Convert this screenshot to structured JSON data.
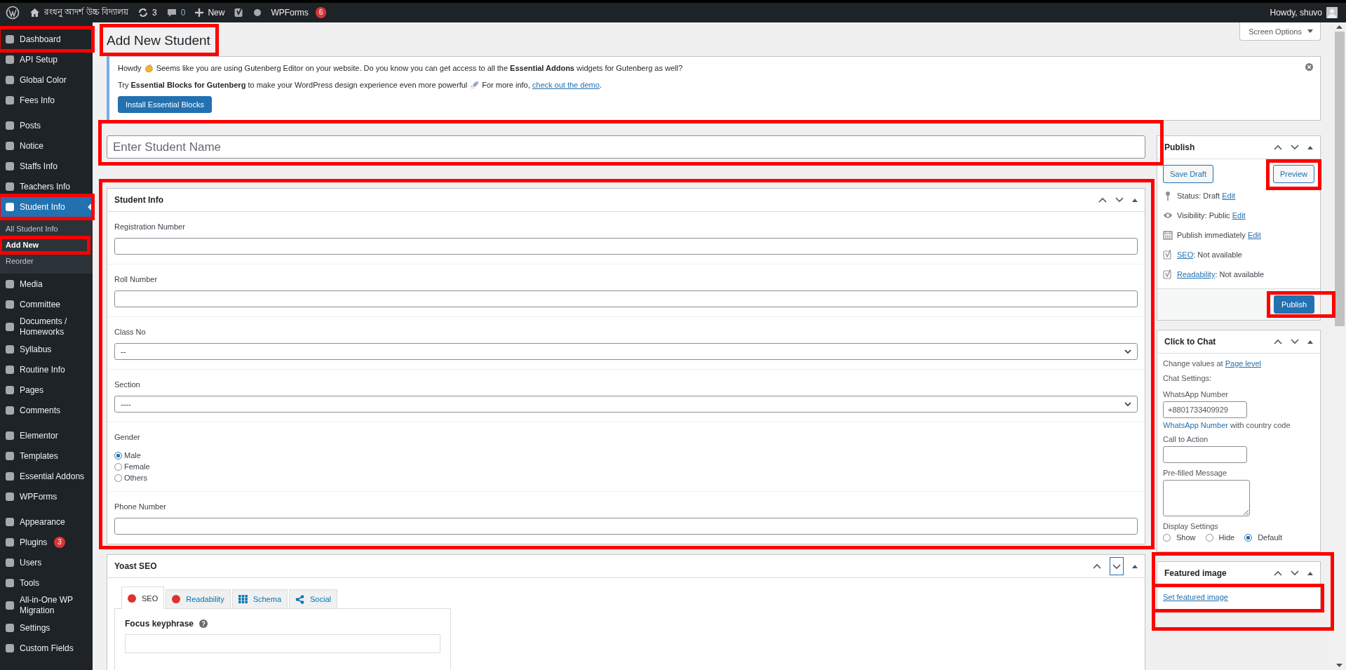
{
  "admin_bar": {
    "site_name": "রংধনু আদর্শ উচ্চ বিদ্যালয়",
    "updates": "3",
    "comments": "0",
    "new": "New",
    "wpforms": "WPForms",
    "wpforms_badge": "6",
    "greeting": "Howdy, shuvo"
  },
  "sidebar": {
    "groups": [
      {
        "items": [
          {
            "label": "Dashboard",
            "current": false,
            "highlighted": true
          },
          {
            "label": "API Setup",
            "current": false,
            "highlighted": false
          },
          {
            "label": "Global Color",
            "current": false,
            "highlighted": false
          },
          {
            "label": "Fees Info",
            "current": false,
            "highlighted": false
          }
        ]
      },
      {
        "items": [
          {
            "label": "Posts",
            "current": false,
            "highlighted": false
          },
          {
            "label": "Notice",
            "current": false,
            "highlighted": false
          },
          {
            "label": "Staffs Info",
            "current": false,
            "highlighted": false
          },
          {
            "label": "Teachers Info",
            "current": false,
            "highlighted": false
          },
          {
            "label": "Student Info",
            "current": true,
            "highlighted": true,
            "submenu": [
              {
                "label": "All Student Info",
                "current": false,
                "highlighted": false
              },
              {
                "label": "Add New",
                "current": true,
                "highlighted": true
              },
              {
                "label": "Reorder",
                "current": false,
                "highlighted": false
              }
            ]
          },
          {
            "label": "Media",
            "current": false,
            "highlighted": false
          },
          {
            "label": "Committee",
            "current": false,
            "highlighted": false
          },
          {
            "label": "Documents / Homeworks",
            "current": false,
            "highlighted": false
          },
          {
            "label": "Syllabus",
            "current": false,
            "highlighted": false
          },
          {
            "label": "Routine Info",
            "current": false,
            "highlighted": false
          },
          {
            "label": "Pages",
            "current": false,
            "highlighted": false
          },
          {
            "label": "Comments",
            "current": false,
            "highlighted": false
          }
        ]
      },
      {
        "items": [
          {
            "label": "Elementor",
            "current": false,
            "highlighted": false
          },
          {
            "label": "Templates",
            "current": false,
            "highlighted": false
          },
          {
            "label": "Essential Addons",
            "current": false,
            "highlighted": false
          },
          {
            "label": "WPForms",
            "current": false,
            "highlighted": false
          }
        ]
      },
      {
        "items": [
          {
            "label": "Appearance",
            "current": false,
            "highlighted": false
          },
          {
            "label": "Plugins",
            "badge": "3",
            "current": false,
            "highlighted": false
          },
          {
            "label": "Users",
            "current": false,
            "highlighted": false
          },
          {
            "label": "Tools",
            "current": false,
            "highlighted": false
          },
          {
            "label": "All-in-One WP Migration",
            "current": false,
            "highlighted": false
          },
          {
            "label": "Settings",
            "current": false,
            "highlighted": false
          },
          {
            "label": "Custom Fields",
            "current": false,
            "highlighted": false
          }
        ]
      }
    ]
  },
  "screen_options": "Screen Options",
  "heading": {
    "text": "Add New Student",
    "highlighted": true
  },
  "notice": {
    "line1_before": "Howdy",
    "line1_after": "Seems like you are using Gutenberg Editor on your website. Do you know you can get access to all the **Essential Addons** widgets for Gutenberg as well?",
    "line2_before": "Try **Essential Blocks for Gutenberg** to make your WordPress design experience even more powerful",
    "line2_after": "For more info,",
    "link": "check out the demo",
    "line2_end": ".",
    "button": "Install Essential Blocks"
  },
  "title_field": {
    "placeholder": "Enter Student Name",
    "highlighted": true
  },
  "student_info": {
    "title": "Student Info",
    "highlighted": true,
    "fields": [
      {
        "kind": "text",
        "label": "Registration Number"
      },
      {
        "kind": "text",
        "label": "Roll Number"
      },
      {
        "kind": "select",
        "label": "Class No",
        "value": "--"
      },
      {
        "kind": "select",
        "label": "Section",
        "value": "----"
      },
      {
        "kind": "radio",
        "label": "Gender",
        "options": [
          {
            "label": "Male",
            "selected": true
          },
          {
            "label": "Female",
            "selected": false
          },
          {
            "label": "Others",
            "selected": false
          }
        ]
      },
      {
        "kind": "text",
        "label": "Phone Number"
      }
    ]
  },
  "yoast": {
    "title": "Yoast SEO",
    "tabs": [
      {
        "kind": "score",
        "label": "SEO",
        "selected": true
      },
      {
        "kind": "score",
        "label": "Readability",
        "selected": false
      },
      {
        "kind": "schema",
        "label": "Schema",
        "selected": false
      },
      {
        "kind": "social",
        "label": "Social",
        "selected": false
      }
    ],
    "focus_label": "Focus keyphrase"
  },
  "publish": {
    "title": "Publish",
    "save_draft": "Save Draft",
    "preview": {
      "label": "Preview",
      "highlighted": true
    },
    "rows": [
      {
        "kind": "pin",
        "before": "Status: Draft",
        "link": "Edit"
      },
      {
        "kind": "eye",
        "before": "Visibility: Public",
        "link": "Edit"
      },
      {
        "kind": "calendar",
        "before": "Publish immediately",
        "link": "Edit"
      },
      {
        "kind": "yoast",
        "link": "SEO",
        "after": ": Not available"
      },
      {
        "kind": "yoast",
        "link": "Readability",
        "after": ": Not available"
      }
    ],
    "button": {
      "label": "Publish",
      "highlighted": true
    }
  },
  "chat": {
    "title": "Click to Chat",
    "intro": "Change values at",
    "intro_link": "Page level",
    "settings": "Chat Settings:",
    "number_label": "WhatsApp Number",
    "number_value": "+8801733409929",
    "hint_link": "WhatsApp Number",
    "hint": "with country code",
    "cta_label": "Call to Action",
    "message_label": "Pre-filled Message",
    "display_label": "Display Settings",
    "display_options": [
      {
        "label": "Show",
        "selected": false
      },
      {
        "label": "Hide",
        "selected": false
      },
      {
        "label": "Default",
        "selected": true
      }
    ]
  },
  "featured": {
    "title": "Featured image",
    "highlighted": true,
    "link": "Set featured image",
    "link_highlighted": true
  }
}
